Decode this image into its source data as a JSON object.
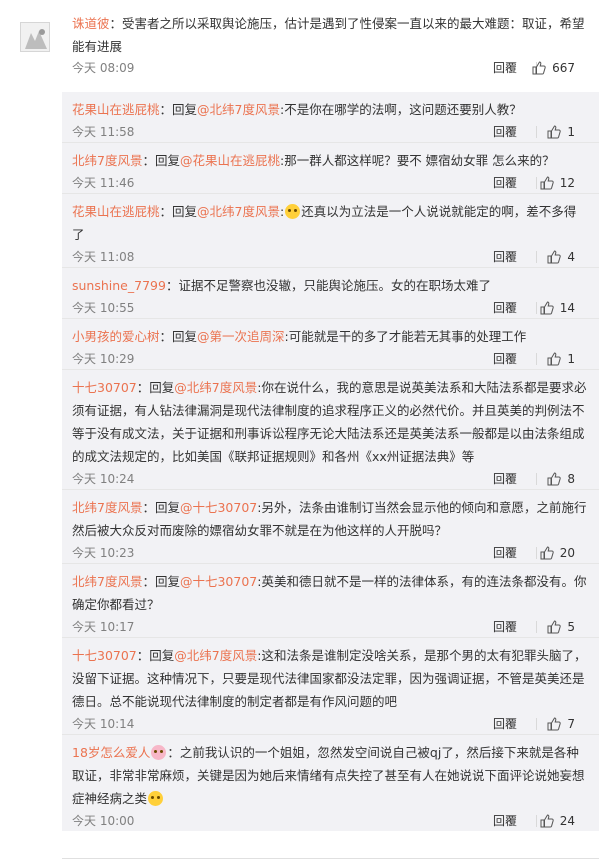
{
  "main": {
    "user": "诛道彼",
    "text": "：受害者之所以采取舆论施压，估计是遇到了性侵案一直以来的最大难题：取证，希望能有进展",
    "time": "今天 08:09",
    "reply_label": "回覆",
    "likes": "667"
  },
  "replies": [
    {
      "user": "花果山在逃屁桃",
      "p1": "：回复",
      "mention": "@北纬7度风景",
      "text": ":不是你在哪学的法啊，这问题还要别人教？",
      "emoji": "",
      "text2": "",
      "time": "今天 11:58",
      "reply_label": "回覆",
      "likes": "1"
    },
    {
      "user": "北纬7度风景",
      "p1": "：回复",
      "mention": "@花果山在逃屁桃",
      "text": ":那一群人都这样呢？要不 嫖宿幼女罪 怎么来的？",
      "emoji": "",
      "text2": "",
      "time": "今天 11:46",
      "reply_label": "回覆",
      "likes": "12"
    },
    {
      "user": "花果山在逃屁桃",
      "p1": "：回复",
      "mention": "@北纬7度风景",
      "text": ":",
      "emoji": "sleepy-emoji",
      "text2": "还真以为立法是一个人说说就能定的啊，差不多得了",
      "time": "今天 11:08",
      "reply_label": "回覆",
      "likes": "4"
    },
    {
      "user": "sunshine_7799",
      "p1": "",
      "mention": "",
      "text": "：证据不足警察也没辙，只能舆论施压。女的在职场太难了",
      "emoji": "",
      "text2": "",
      "time": "今天 10:55",
      "reply_label": "回覆",
      "likes": "14"
    },
    {
      "user": "小男孩的爱心树",
      "p1": "：回复",
      "mention": "@第一次追周深",
      "text": ":可能就是干的多了才能若无其事的处理工作",
      "emoji": "",
      "text2": "",
      "time": "今天 10:29",
      "reply_label": "回覆",
      "likes": "1"
    },
    {
      "user": "十七30707",
      "p1": "：回复",
      "mention": "@北纬7度风景",
      "text": ":你在说什么，我的意思是说英美法系和大陆法系都是要求必须有证据，有人钻法律漏洞是现代法律制度的追求程序正义的必然代价。并且英美的判例法不等于没有成文法，关于证据和刑事诉讼程序无论大陆法系还是英美法系一般都是以由法条组成的成文法规定的，比如美国《联邦证据规则》和各州《xx州证据法典》等",
      "emoji": "",
      "text2": "",
      "time": "今天 10:24",
      "reply_label": "回覆",
      "likes": "8"
    },
    {
      "user": "北纬7度风景",
      "p1": "：回复",
      "mention": "@十七30707",
      "text": ":另外，法条由谁制订当然会显示他的倾向和意愿，之前施行然后被大众反对而废除的嫖宿幼女罪不就是在为他这样的人开脱吗？",
      "emoji": "",
      "text2": "",
      "time": "今天 10:23",
      "reply_label": "回覆",
      "likes": "20"
    },
    {
      "user": "北纬7度风景",
      "p1": "：回复",
      "mention": "@十七30707",
      "text": ":英美和德日就不是一样的法律体系，有的连法条都没有。你确定你都看过？",
      "emoji": "",
      "text2": "",
      "time": "今天 10:17",
      "reply_label": "回覆",
      "likes": "5"
    },
    {
      "user": "十七30707",
      "p1": "：回复",
      "mention": "@北纬7度风景",
      "text": ":这和法条是谁制定没啥关系，是那个男的太有犯罪头脑了，没留下证据。这种情况下，只要是现代法律国家都没法定罪，因为强调证据，不管是英美还是德日。总不能说现代法律制度的制定者都是有作风问题的吧",
      "emoji": "",
      "text2": "",
      "time": "今天 10:14",
      "reply_label": "回覆",
      "likes": "7"
    },
    {
      "user": "18岁怎么爱人",
      "p1": "",
      "mention": "",
      "text": "",
      "emoji": "badge-emoji",
      "text2": "：之前我认识的一个姐姐，忽然发空间说自己被qj了，然后接下来就是各种取证，非常非常麻烦，关键是因为她后来情绪有点失控了甚至有人在她说说下面评论说她妄想症神经病之类",
      "emoji2": "shy-emoji",
      "time": "今天 10:00",
      "reply_label": "回覆",
      "likes": "24"
    }
  ]
}
